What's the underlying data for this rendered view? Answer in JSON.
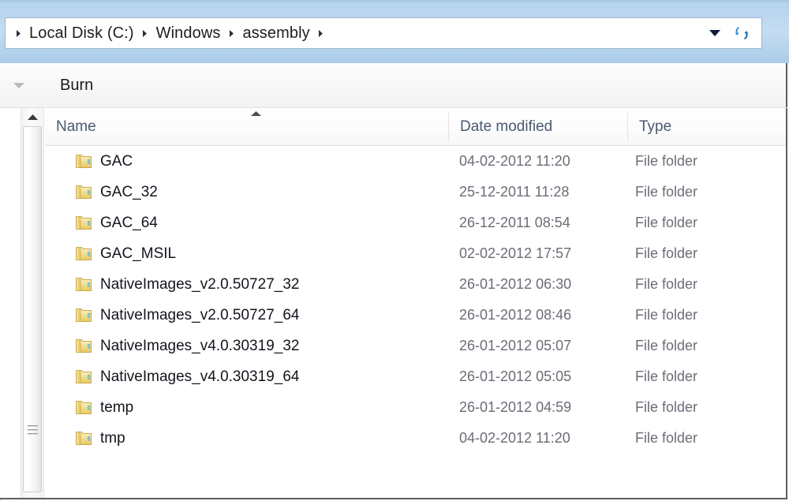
{
  "window": {
    "accent_blue": "#b6d4ee",
    "border_color": "#5d5d5d"
  },
  "address_bar": {
    "breadcrumbs": [
      {
        "label": "Local Disk (C:)"
      },
      {
        "label": "Windows"
      },
      {
        "label": "assembly"
      }
    ],
    "dropdown_icon": "chevron-down-icon",
    "refresh_icon": "refresh-icon"
  },
  "toolbar": {
    "expand_icon": "chevron-down-icon",
    "burn_label": "Burn"
  },
  "scrollbar": {
    "up_arrow_icon": "scroll-up-arrow-icon",
    "grip_icon": "scrollbar-grip-icon"
  },
  "columns": [
    {
      "key": "name",
      "label": "Name",
      "sorted": true,
      "sort_direction": "ascending"
    },
    {
      "key": "date_modified",
      "label": "Date modified",
      "sorted": false
    },
    {
      "key": "type",
      "label": "Type",
      "sorted": false
    }
  ],
  "files": [
    {
      "icon": "folder-icon",
      "name": "GAC",
      "date_modified": "04-02-2012 11:20",
      "type": "File folder"
    },
    {
      "icon": "folder-icon",
      "name": "GAC_32",
      "date_modified": "25-12-2011 11:28",
      "type": "File folder"
    },
    {
      "icon": "folder-icon",
      "name": "GAC_64",
      "date_modified": "26-12-2011 08:54",
      "type": "File folder"
    },
    {
      "icon": "folder-icon",
      "name": "GAC_MSIL",
      "date_modified": "02-02-2012 17:57",
      "type": "File folder"
    },
    {
      "icon": "folder-icon",
      "name": "NativeImages_v2.0.50727_32",
      "date_modified": "26-01-2012 06:30",
      "type": "File folder"
    },
    {
      "icon": "folder-icon",
      "name": "NativeImages_v2.0.50727_64",
      "date_modified": "26-01-2012 08:46",
      "type": "File folder"
    },
    {
      "icon": "folder-icon",
      "name": "NativeImages_v4.0.30319_32",
      "date_modified": "26-01-2012 05:07",
      "type": "File folder"
    },
    {
      "icon": "folder-icon",
      "name": "NativeImages_v4.0.30319_64",
      "date_modified": "26-01-2012 05:05",
      "type": "File folder"
    },
    {
      "icon": "folder-icon",
      "name": "temp",
      "date_modified": "26-01-2012 04:59",
      "type": "File folder"
    },
    {
      "icon": "folder-icon",
      "name": "tmp",
      "date_modified": "04-02-2012 11:20",
      "type": "File folder"
    }
  ]
}
